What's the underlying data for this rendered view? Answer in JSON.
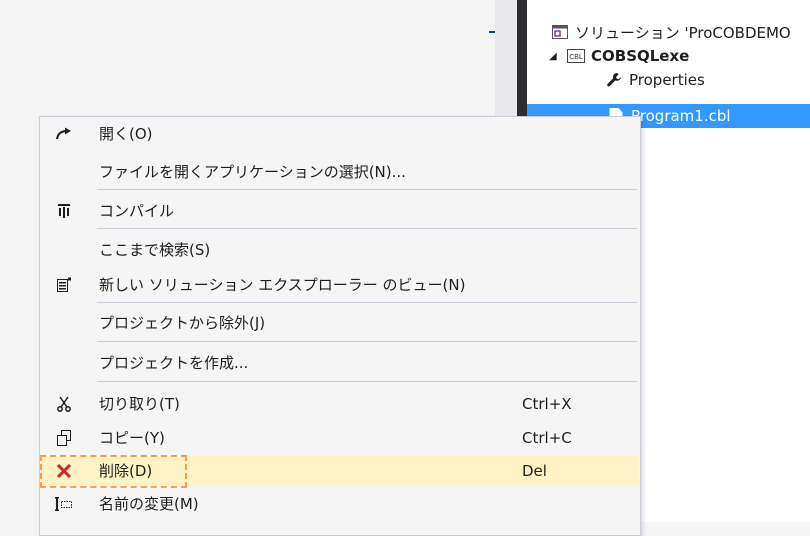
{
  "solution_explorer": {
    "solution_label": "ソリューション 'ProCOBDEMO",
    "project_label": "COBSQLexe",
    "project_icon_text": "CBL",
    "properties_label": "Properties",
    "selected_file_label": "Program1.cbl"
  },
  "context_menu": {
    "items": [
      {
        "label": "開く(O)",
        "icon": "open-arrow-icon"
      },
      {
        "label": "ファイルを開くアプリケーションの選択(N)..."
      },
      {
        "label": "コンパイル",
        "icon": "compile-icon"
      },
      {
        "label": "ここまで検索(S)"
      },
      {
        "label": "新しい ソリューション エクスプローラー のビュー(N)",
        "icon": "new-view-icon"
      },
      {
        "label": "プロジェクトから除外(J)"
      },
      {
        "label": "プロジェクトを作成..."
      },
      {
        "label": "切り取り(T)",
        "shortcut": "Ctrl+X",
        "icon": "scissors-icon"
      },
      {
        "label": "コピー(Y)",
        "shortcut": "Ctrl+C",
        "icon": "copy-icon"
      },
      {
        "label": "削除(D)",
        "shortcut": "Del",
        "icon": "delete-x-icon"
      },
      {
        "label": "名前の変更(M)",
        "icon": "rename-icon"
      }
    ]
  },
  "colors": {
    "selection": "#3399ff",
    "menu_highlight": "#fff2c4",
    "delete_icon": "#cc2222",
    "annotation": "#f5a04e"
  }
}
